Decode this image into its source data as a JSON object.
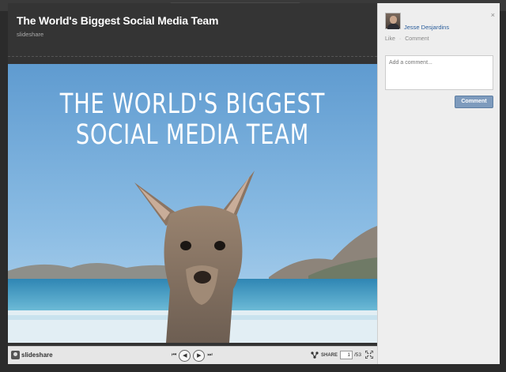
{
  "deck": {
    "title": "The World's Biggest Social Media Team",
    "source": "slideshare"
  },
  "slide": {
    "text": "THE WORLD'S BIGGEST\nSOCIAL MEDIA TEAM"
  },
  "toolbar": {
    "brand": "slideshare",
    "first": "⏮",
    "prev": "◀",
    "next": "▶",
    "last": "⏭",
    "share_label": "SHARE",
    "current_page": "1",
    "total_pages": "/53"
  },
  "panel": {
    "close": "×",
    "user_name": "Jesse Desjardins",
    "like": "Like",
    "separator": "·",
    "comment_link": "Comment",
    "comment_placeholder": "Add a comment...",
    "comment_button": "Comment"
  },
  "icons": {
    "share": "share-icon",
    "fullscreen": "fullscreen-icon",
    "close": "close-icon"
  }
}
